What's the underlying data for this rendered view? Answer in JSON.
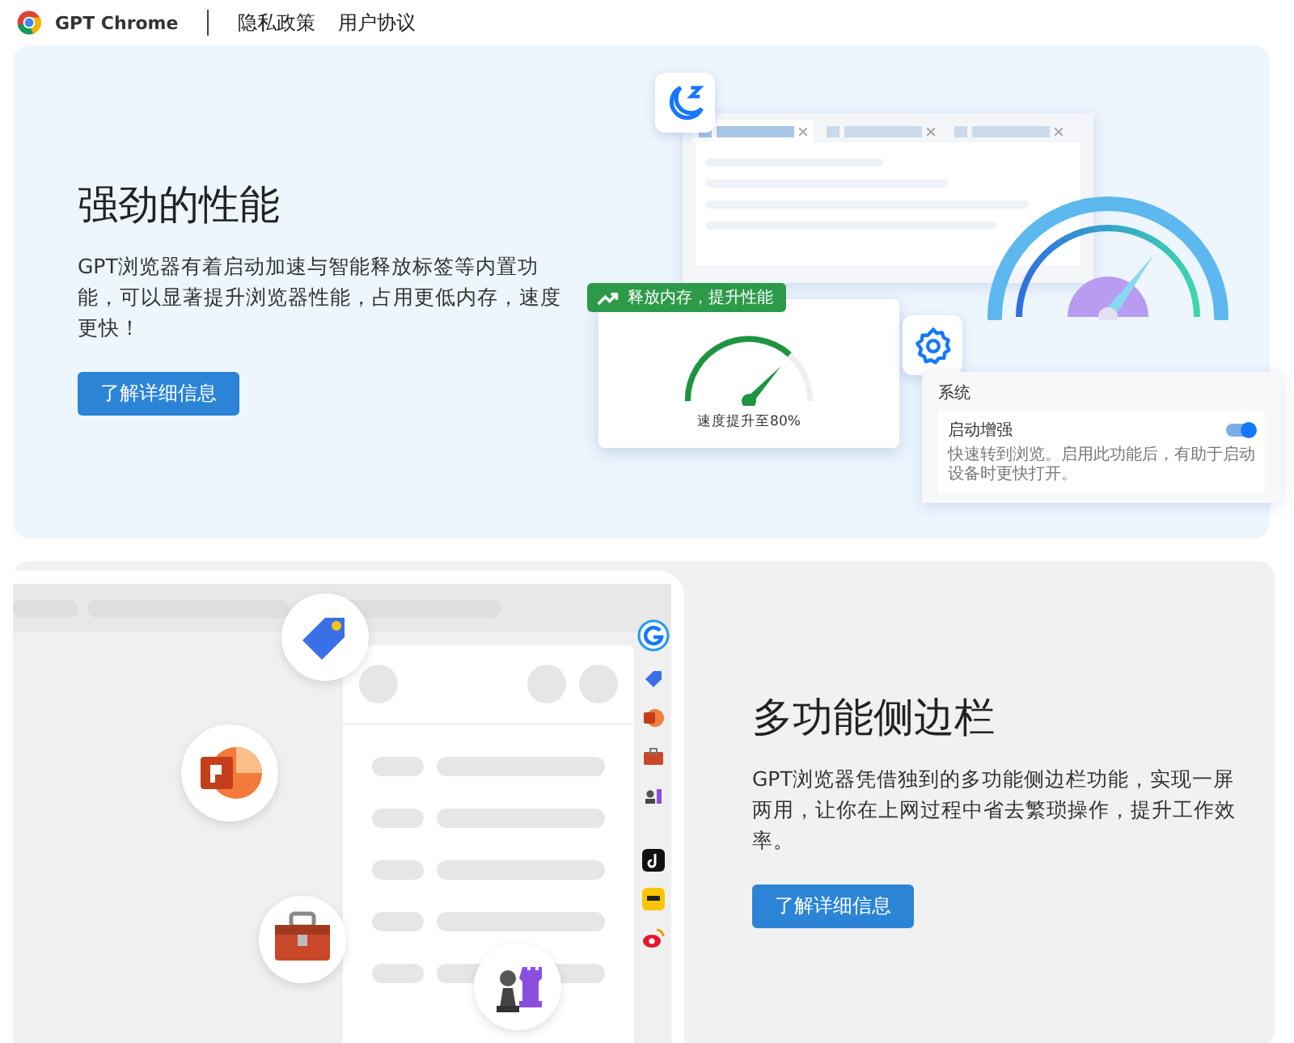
{
  "header": {
    "brand": "GPT Chrome",
    "links": [
      "隐私政策",
      "用户协议"
    ]
  },
  "performance": {
    "title": "强劲的性能",
    "text": "GPT浏览器有着启动加速与智能释放标签等内置功能，可以显著提升浏览器性能，占用更低内存，速度更快！",
    "button": "了解详细信息",
    "badge": "释放内存，提升性能",
    "gauge_caption": "速度提升至80%",
    "settings": {
      "title": "系统",
      "option": "启动增强",
      "description": "快速转到浏览。启用此功能后，有助于启动设备时更快打开。",
      "on": true
    }
  },
  "sidebar": {
    "title": "多功能侧边栏",
    "text": "GPT浏览器凭借独到的多功能侧边栏功能，实现一屏两用，让你在上网过程中省去繁琐操作，提升工作效率。",
    "button": "了解详细信息"
  }
}
